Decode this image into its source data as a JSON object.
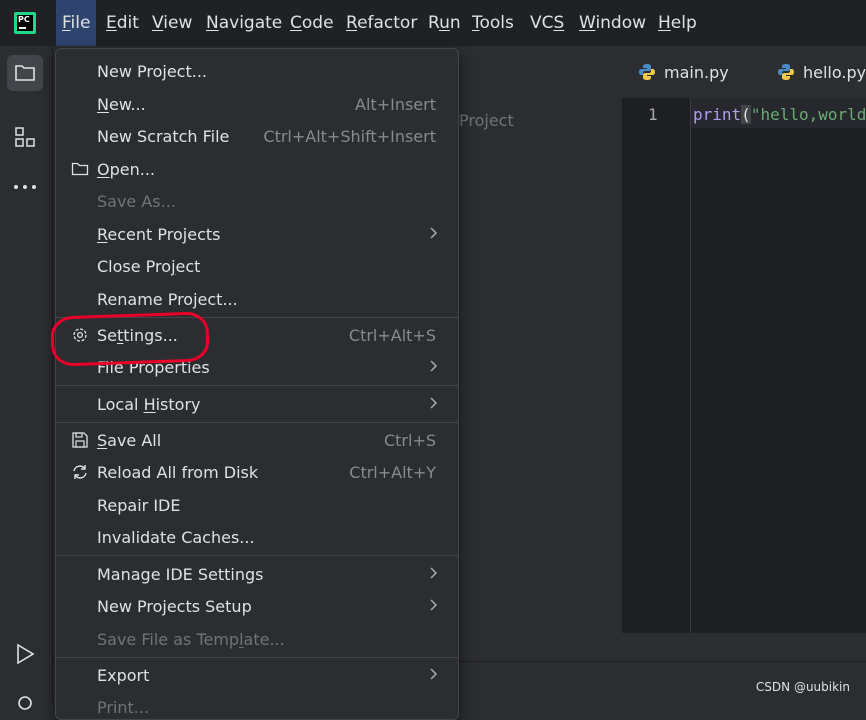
{
  "menubar": {
    "items": [
      {
        "pre": "",
        "u": "F",
        "post": "ile"
      },
      {
        "pre": "",
        "u": "E",
        "post": "dit"
      },
      {
        "pre": "",
        "u": "V",
        "post": "iew"
      },
      {
        "pre": "",
        "u": "N",
        "post": "avigate"
      },
      {
        "pre": "",
        "u": "C",
        "post": "ode"
      },
      {
        "pre": "",
        "u": "R",
        "post": "efactor"
      },
      {
        "pre": "R",
        "u": "u",
        "post": "n"
      },
      {
        "pre": "",
        "u": "T",
        "post": "ools"
      },
      {
        "pre": "VC",
        "u": "S",
        "post": ""
      },
      {
        "pre": "",
        "u": "W",
        "post": "indow"
      },
      {
        "pre": "",
        "u": "H",
        "post": "elp"
      }
    ]
  },
  "logo": {
    "text": "PC"
  },
  "project_pane": {
    "hint": "Project"
  },
  "tabs": [
    {
      "label": "main.py",
      "icon": "python-icon"
    },
    {
      "label": "hello.py",
      "icon": "python-icon"
    }
  ],
  "editor": {
    "line_number": "1",
    "code": {
      "fn": "print",
      "open": "(",
      "str": "\"hello,world"
    }
  },
  "file_menu": {
    "items": [
      {
        "pre": "New Project...",
        "u": "",
        "post": "",
        "shortcut": "",
        "submenu": false,
        "disabled": false
      },
      {
        "pre": "",
        "u": "N",
        "post": "ew...",
        "shortcut": "Alt+Insert",
        "submenu": false,
        "disabled": false
      },
      {
        "pre": "New Scratch File",
        "u": "",
        "post": "",
        "shortcut": "Ctrl+Alt+Shift+Insert",
        "submenu": false,
        "disabled": false
      },
      {
        "pre": "",
        "u": "O",
        "post": "pen...",
        "shortcut": "",
        "submenu": false,
        "disabled": false,
        "icon": "folder-icon"
      },
      {
        "pre": "Save As...",
        "u": "",
        "post": "",
        "shortcut": "",
        "submenu": false,
        "disabled": true
      },
      {
        "pre": "",
        "u": "R",
        "post": "ecent Projects",
        "shortcut": "",
        "submenu": true,
        "disabled": false
      },
      {
        "pre": "Close Pro",
        "u": "j",
        "post": "ect",
        "shortcut": "",
        "submenu": false,
        "disabled": false
      },
      {
        "pre": "Rename Project...",
        "u": "",
        "post": "",
        "shortcut": "",
        "submenu": false,
        "disabled": false
      },
      {
        "pre": "Se",
        "u": "t",
        "post": "tings...",
        "shortcut": "Ctrl+Alt+S",
        "submenu": false,
        "disabled": false,
        "icon": "gear-icon"
      },
      {
        "pre": "File Properties",
        "u": "",
        "post": "",
        "shortcut": "",
        "submenu": true,
        "disabled": false
      },
      {
        "pre": "Local ",
        "u": "H",
        "post": "istory",
        "shortcut": "",
        "submenu": true,
        "disabled": false
      },
      {
        "pre": "",
        "u": "S",
        "post": "ave All",
        "shortcut": "Ctrl+S",
        "submenu": false,
        "disabled": false,
        "icon": "save-icon"
      },
      {
        "pre": "Reload All from Disk",
        "u": "",
        "post": "",
        "shortcut": "Ctrl+Alt+Y",
        "submenu": false,
        "disabled": false,
        "icon": "reload-icon"
      },
      {
        "pre": "Repair IDE",
        "u": "",
        "post": "",
        "shortcut": "",
        "submenu": false,
        "disabled": false
      },
      {
        "pre": "Invalidate Caches...",
        "u": "",
        "post": "",
        "shortcut": "",
        "submenu": false,
        "disabled": false
      },
      {
        "pre": "Manage IDE Settings",
        "u": "",
        "post": "",
        "shortcut": "",
        "submenu": true,
        "disabled": false
      },
      {
        "pre": "New Projects Setup",
        "u": "",
        "post": "",
        "shortcut": "",
        "submenu": true,
        "disabled": false
      },
      {
        "pre": "Save File as Temp",
        "u": "l",
        "post": "ate...",
        "shortcut": "",
        "submenu": false,
        "disabled": true
      },
      {
        "pre": "Export",
        "u": "",
        "post": "",
        "shortcut": "",
        "submenu": true,
        "disabled": false
      },
      {
        "pre": "Print...",
        "u": "",
        "post": "",
        "shortcut": "",
        "submenu": false,
        "disabled": true
      }
    ]
  },
  "watermark": "CSDN @uubikin",
  "colors": {
    "accent": "#2e436e",
    "annotation": "#e8002a",
    "logo": "#21d789"
  }
}
